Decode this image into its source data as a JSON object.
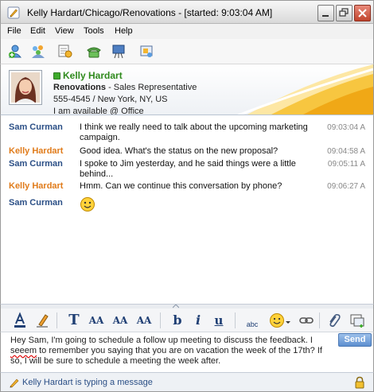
{
  "window": {
    "title": "Kelly Hardart/Chicago/Renovations - [started: 9:03:04 AM]",
    "icon": "pencil-app-icon"
  },
  "menu": [
    "File",
    "Edit",
    "View",
    "Tools",
    "Help"
  ],
  "toolbar_icons": [
    "add-contact-icon",
    "group-icon",
    "share-icon",
    "phone-icon",
    "video-icon",
    "meeting-icon"
  ],
  "contact": {
    "name": "Kelly Hardart",
    "company": "Renovations",
    "role": " - Sales Representative",
    "phone_location": "555-4545 / New York, NY, US",
    "status": "I am available @ Office",
    "presence_color": "#3caa2a"
  },
  "messages": [
    {
      "sender": "Sam Curman",
      "who": "sam",
      "text": "I think we really need to talk about the upcoming marketing campaign.",
      "time": "09:03:04 A"
    },
    {
      "sender": "Kelly Hardart",
      "who": "kelly",
      "text": "Good idea. What's the status on the new proposal?",
      "time": "09:04:58 A"
    },
    {
      "sender": "Sam Curman",
      "who": "sam",
      "text": "I spoke to Jim yesterday, and he said things were a little behind...",
      "time": "09:05:11 A"
    },
    {
      "sender": "Kelly Hardart",
      "who": "kelly",
      "text": "Hmm. Can we continue this conversation by phone?",
      "time": "09:06:27 A"
    },
    {
      "sender": "Sam Curman",
      "who": "sam",
      "text": "",
      "emoticon": "smiley-emoticon",
      "time": ""
    }
  ],
  "format_toolbar": {
    "text_color": "text-color-icon",
    "highlight": "highlighter-icon",
    "font": "T",
    "font_size": "AA",
    "grow": "AA",
    "shrink": "AA",
    "bold": "b",
    "italic": "i",
    "underline": "u",
    "spell": "abc",
    "emoticon": "smiley-icon",
    "link": "link-icon",
    "attach": "paperclip-icon",
    "screen": "screen-capture-icon"
  },
  "compose": {
    "text_pre": "Hey Sam, I'm going to schedule a follow up meeting to discuss the feedback. I ",
    "misspelled": "seeem",
    "text_post": " to remember you saying that you are on vacation the week of the 17th? If so, I will be sure to schedule a meeting the week after.",
    "send_label": "Send"
  },
  "status": {
    "text": "Kelly Hardart is typing a message"
  },
  "colors": {
    "sam": "#2b4f86",
    "kelly": "#e07b1a",
    "accent": "#5d8fd0"
  }
}
